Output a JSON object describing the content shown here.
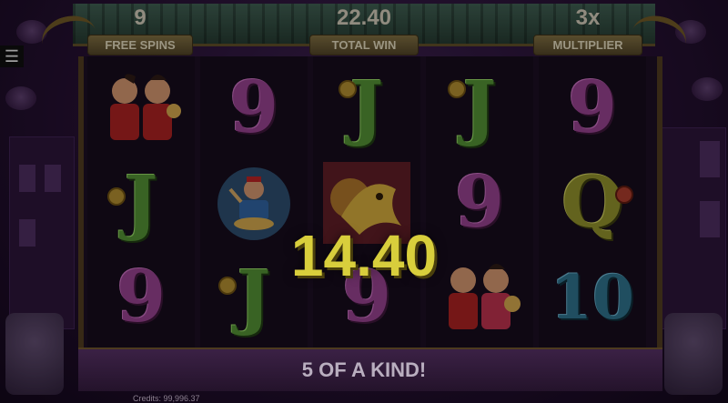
{
  "hud": {
    "free_spins": {
      "value": "9",
      "label": "FREE SPINS"
    },
    "total_win": {
      "value": "22.40",
      "label": "TOTAL WIN"
    },
    "multiplier": {
      "value": "3x",
      "label": "MULTIPLIER"
    }
  },
  "menu_icon": "☰",
  "reels": [
    [
      "lucky-couple-symbol",
      "J",
      "9"
    ],
    [
      "9",
      "drummer-symbol",
      "J"
    ],
    [
      "J",
      "dragon-symbol",
      "9"
    ],
    [
      "J",
      "9",
      "lucky-couple-symbol"
    ],
    [
      "9",
      "Q",
      "10"
    ]
  ],
  "win_amount": "14.40",
  "win_message": "5 OF A KIND!",
  "credits": "Credits: 99,996.37",
  "colors": {
    "background": "#2a1436",
    "win_text": "#d8ce3c",
    "roof": "#3d5b4f"
  }
}
